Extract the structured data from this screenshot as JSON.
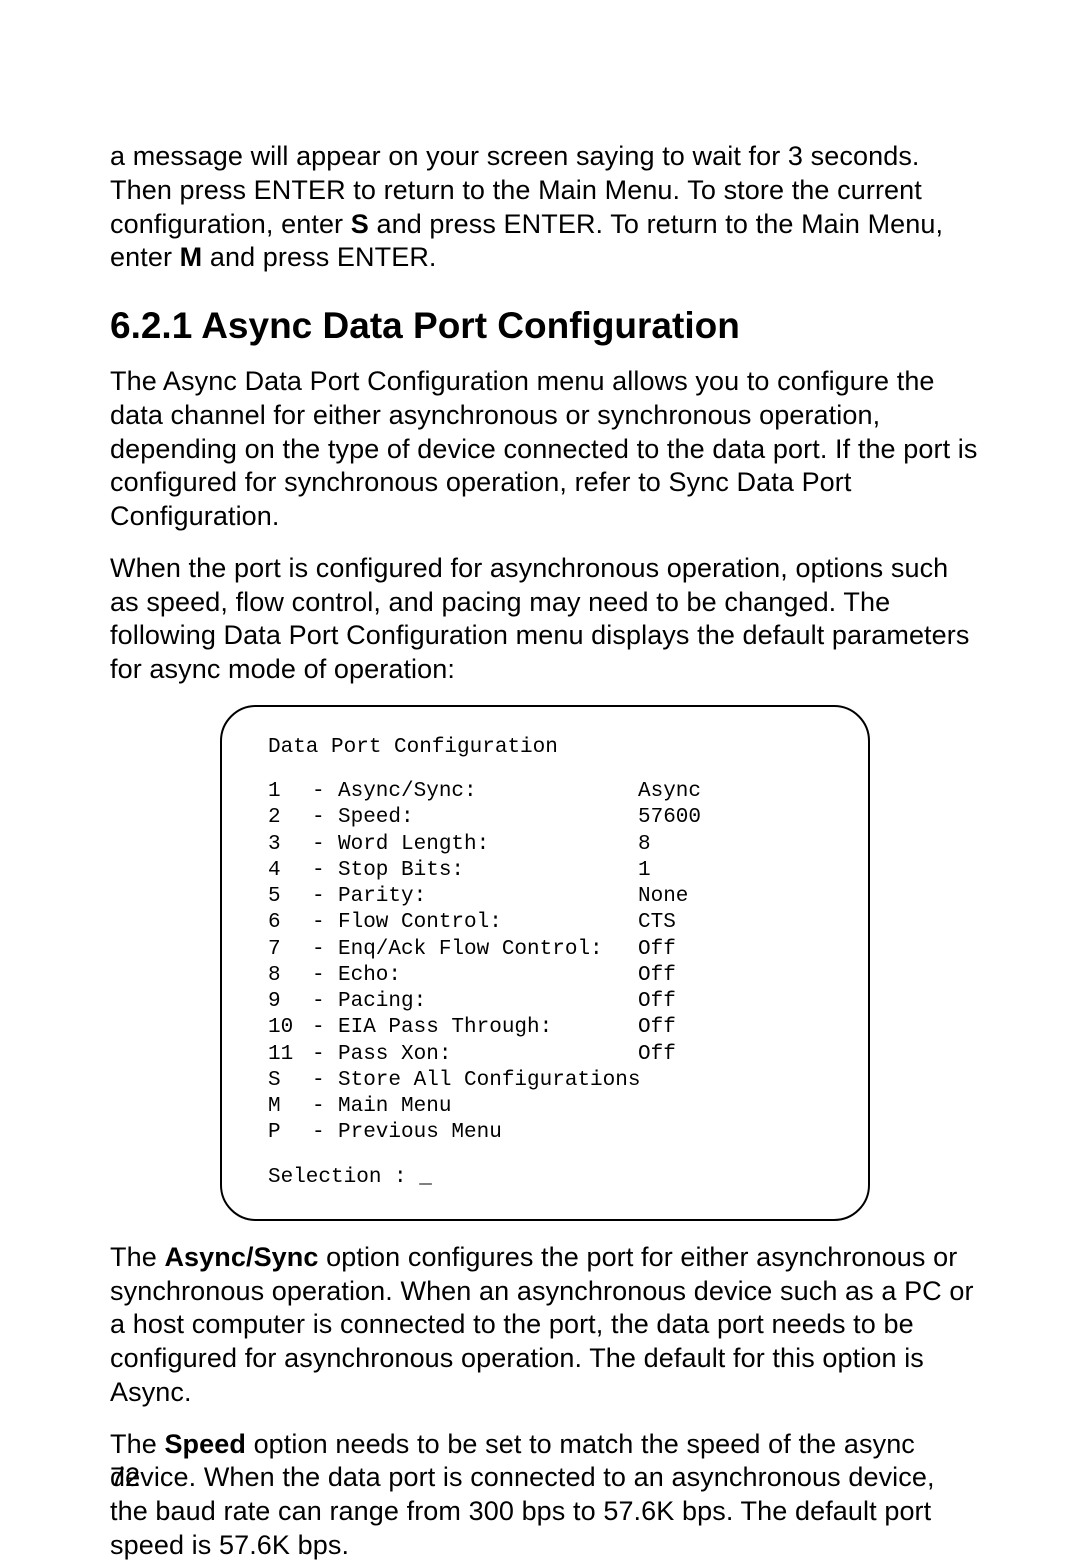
{
  "para_intro": "a message will appear on your screen saying to wait for 3 seconds. Then press ENTER to return to the Main Menu. To store the current configuration, enter ",
  "para_intro_bold1": "S",
  "para_intro_mid": " and press ENTER. To return to the Main Menu, enter ",
  "para_intro_bold2": "M",
  "para_intro_end": " and press ENTER.",
  "section_heading": "6.2.1   Async Data Port Configuration",
  "para_desc1": "The Async Data Port Configuration menu allows you to configure the data channel for either asynchronous or synchronous operation, depending on the type of device connected to the data port. If the port is configured for synchronous operation, refer to Sync Data Port Configuration.",
  "para_desc2": "When the port is configured for asynchronous operation, options such as speed, flow control, and pacing may need to be changed. The following Data Port Configuration menu displays the default parameters for async mode of operation:",
  "terminal": {
    "title": "Data Port Configuration",
    "rows": [
      {
        "key": "1",
        "label": "Async/Sync:",
        "value": "Async"
      },
      {
        "key": "2",
        "label": "Speed:",
        "value": "57600"
      },
      {
        "key": "3",
        "label": "Word Length:",
        "value": "8"
      },
      {
        "key": "4",
        "label": "Stop Bits:",
        "value": "1"
      },
      {
        "key": "5",
        "label": "Parity:",
        "value": "None"
      },
      {
        "key": "6",
        "label": "Flow Control:",
        "value": "CTS"
      },
      {
        "key": "7",
        "label": "Enq/Ack Flow Control:",
        "value": "Off"
      },
      {
        "key": "8",
        "label": "Echo:",
        "value": "Off"
      },
      {
        "key": "9",
        "label": "Pacing:",
        "value": "Off"
      },
      {
        "key": "10",
        "label": "EIA Pass Through:",
        "value": "Off"
      },
      {
        "key": "11",
        "label": "Pass Xon:",
        "value": "Off"
      },
      {
        "key": "S",
        "label": "Store All Configurations",
        "value": ""
      },
      {
        "key": "M",
        "label": "Main Menu",
        "value": ""
      },
      {
        "key": "P",
        "label": "Previous Menu",
        "value": ""
      }
    ],
    "prompt": "Selection : _"
  },
  "para_async_pre": "The ",
  "para_async_bold": "Async/Sync",
  "para_async_post": " option configures the port for either asynchronous or synchronous operation. When an asynchronous device such as a PC or a host computer is connected to the port, the data port needs to be configured for asynchronous operation. The default for this option is Async.",
  "para_speed_pre": "The ",
  "para_speed_bold": "Speed",
  "para_speed_post": " option needs to be set to match the speed of the async device.  When the data port is connected to an asynchronous device, the baud rate can range from 300 bps to 57.6K bps. The default port speed is 57.6K bps.",
  "page_number": "72"
}
